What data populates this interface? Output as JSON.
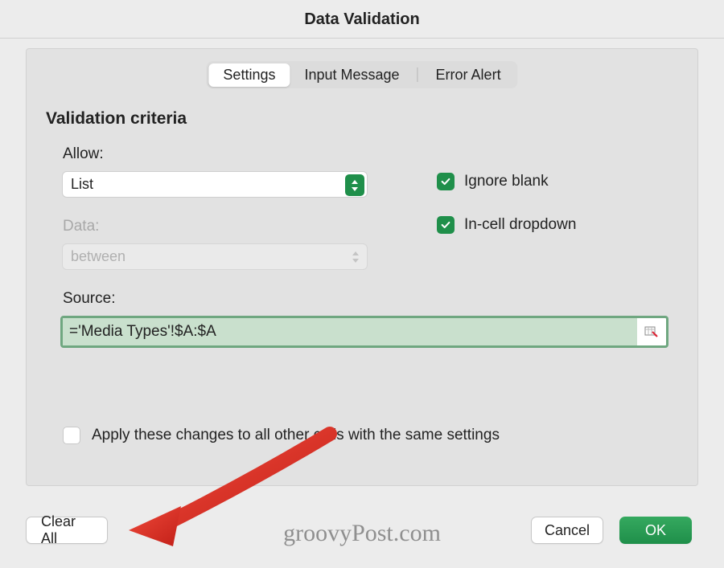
{
  "title": "Data Validation",
  "tabs": {
    "settings": "Settings",
    "input_message": "Input Message",
    "error_alert": "Error Alert"
  },
  "section": {
    "heading": "Validation criteria"
  },
  "fields": {
    "allow_label": "Allow:",
    "allow_value": "List",
    "data_label": "Data:",
    "data_value": "between",
    "source_label": "Source:",
    "source_value": "='Media Types'!$A:$A"
  },
  "checkboxes": {
    "ignore_blank": "Ignore blank",
    "in_cell_dropdown": "In-cell dropdown",
    "apply_all": "Apply these changes to all other cells with the same settings"
  },
  "buttons": {
    "clear_all": "Clear All",
    "cancel": "Cancel",
    "ok": "OK"
  },
  "watermark": "groovyPost.com",
  "colors": {
    "accent_green": "#1f8f4a"
  }
}
